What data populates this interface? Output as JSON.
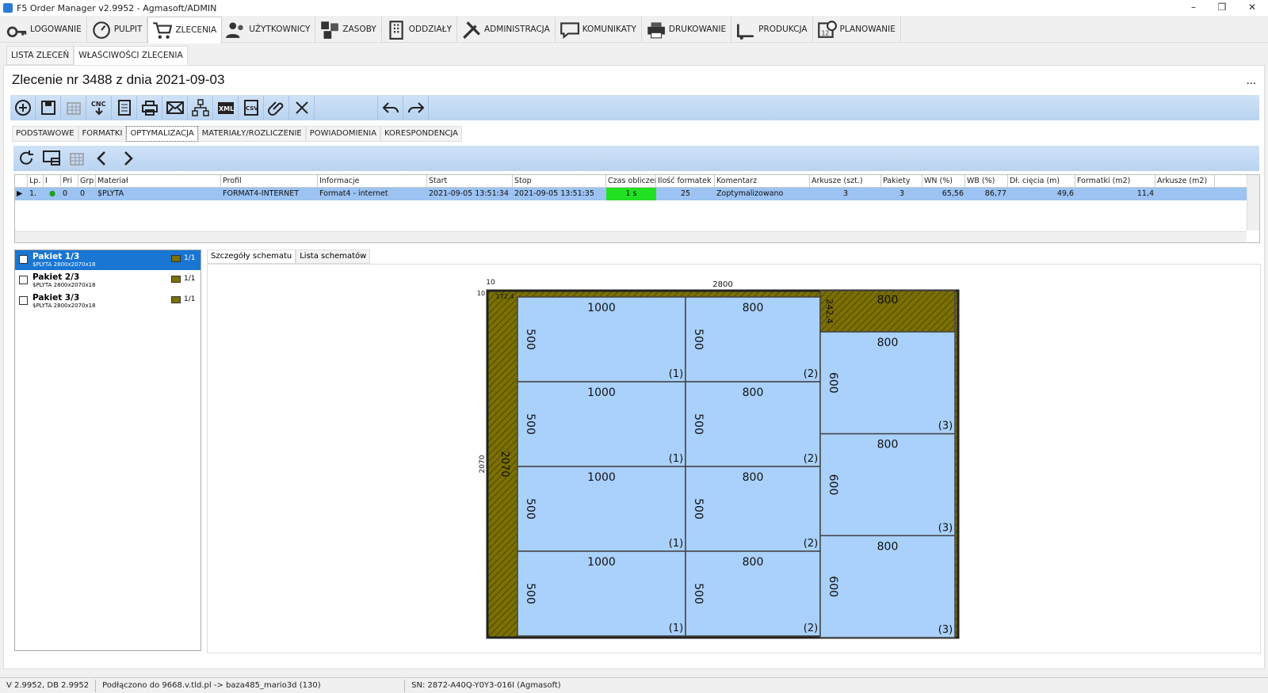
{
  "window": {
    "title": "F5 Order Manager v2.9952 - Agmasoft/ADMIN",
    "minimize": "–",
    "restore": "❐",
    "close": "✕"
  },
  "menu": [
    {
      "label": "LOGOWANIE",
      "icon": "key-icon"
    },
    {
      "label": "PULPIT",
      "icon": "dashboard-icon"
    },
    {
      "label": "ZLECENIA",
      "icon": "cart-icon",
      "active": true
    },
    {
      "label": "UŻYTKOWNICY",
      "icon": "users-icon"
    },
    {
      "label": "ZASOBY",
      "icon": "resources-icon"
    },
    {
      "label": "ODDZIAŁY",
      "icon": "building-icon"
    },
    {
      "label": "ADMINISTRACJA",
      "icon": "tools-icon"
    },
    {
      "label": "KOMUNIKATY",
      "icon": "chat-icon"
    },
    {
      "label": "DRUKOWANIE",
      "icon": "printer-icon"
    },
    {
      "label": "PRODUKCJA",
      "icon": "production-icon"
    },
    {
      "label": "PLANOWANIE",
      "icon": "calendar-icon"
    }
  ],
  "subtabs": [
    "LISTA ZLECEŃ",
    "WŁAŚCIWOŚCI ZLECENIA"
  ],
  "page_title": "Zlecenie nr 3488 z dnia 2021-09-03",
  "more": "...",
  "toolbar1_icons": [
    "add-icon",
    "save-icon",
    "grid-disabled-icon",
    "cnc-icon",
    "document-icon",
    "print-icon",
    "email-icon",
    "network-icon",
    "xml-icon",
    "csv-icon",
    "attach-icon",
    "close-icon",
    "undo-icon",
    "redo-icon"
  ],
  "detail_tabs": [
    "PODSTAWOWE",
    "FORMATKI",
    "OPTYMALIZACJA",
    "MATERIAŁY/ROZLICZENIE",
    "POWIADOMIENIA",
    "KORESPONDENCJA"
  ],
  "toolbar2_icons": [
    "refresh-icon",
    "monitor-icon",
    "grid-disabled-icon",
    "prev-icon",
    "next-icon"
  ],
  "grid": {
    "headers": [
      "",
      "Lp.",
      "I",
      "Pri",
      "Grp",
      "Materiał",
      "Profil",
      "Informacje",
      "Start",
      "Stop",
      "Czas obliczeń",
      "Ilość formatek",
      "Komentarz",
      "Arkusze (szt.)",
      "Pakiety",
      "WN (%)",
      "WB (%)",
      "Dł. cięcia (m)",
      "Formatki (m2)",
      "Arkusze (m2)"
    ],
    "row": [
      "▶",
      "1.",
      "●",
      "0",
      "0",
      "$PLYTA",
      "FORMAT4-INTERNET",
      "Format4 - internet",
      "2021-09-05 13:51:34",
      "2021-09-05 13:51:35",
      "1 s",
      "25",
      "Zoptymalizowano",
      "3",
      "3",
      "65,56",
      "86,77",
      "49,6",
      "11,4",
      ""
    ]
  },
  "packages": [
    {
      "name": "Pakiet 1/3",
      "sub": "$PLYTA 2800x2070x18",
      "count": "1/1",
      "selected": true
    },
    {
      "name": "Pakiet 2/3",
      "sub": "$PLYTA 2800x2070x18",
      "count": "1/1",
      "selected": false
    },
    {
      "name": "Pakiet 3/3",
      "sub": "$PLYTA 2800x2070x18",
      "count": "1/1",
      "selected": false
    }
  ],
  "right_tabs": [
    "Szczegóły schematu",
    "Lista schematów"
  ],
  "scheme": {
    "sheet_width": "2800",
    "sheet_height": "2070",
    "trim_top": "10",
    "trim_left": "10",
    "waste_left_label": "2070",
    "waste_top_label": "172,4",
    "waste_right_top_h": "242,4",
    "waste_right_top_w": "800",
    "col1": [
      {
        "w": "1000",
        "h": "500",
        "id": "(1)"
      },
      {
        "w": "1000",
        "h": "500",
        "id": "(1)"
      },
      {
        "w": "1000",
        "h": "500",
        "id": "(1)"
      },
      {
        "w": "1000",
        "h": "500",
        "id": "(1)"
      }
    ],
    "col2": [
      {
        "w": "800",
        "h": "500",
        "id": "(2)"
      },
      {
        "w": "800",
        "h": "500",
        "id": "(2)"
      },
      {
        "w": "800",
        "h": "500",
        "id": "(2)"
      },
      {
        "w": "800",
        "h": "500",
        "id": "(2)"
      }
    ],
    "col3": [
      {
        "w": "800",
        "h": "600",
        "id": "(3)"
      },
      {
        "w": "800",
        "h": "600",
        "id": "(3)"
      },
      {
        "w": "800",
        "h": "600",
        "id": "(3)"
      }
    ],
    "colors": {
      "waste": "#7b7000",
      "part": "#a9d1fb",
      "border": "#222"
    }
  },
  "status": [
    "V 2.9952, DB 2.9952",
    "Podłączono do 9668.v.tld.pl -> baza485_mario3d (130)",
    "SN: 2872-A40Q-Y0Y3-016I (Agmasoft)"
  ]
}
